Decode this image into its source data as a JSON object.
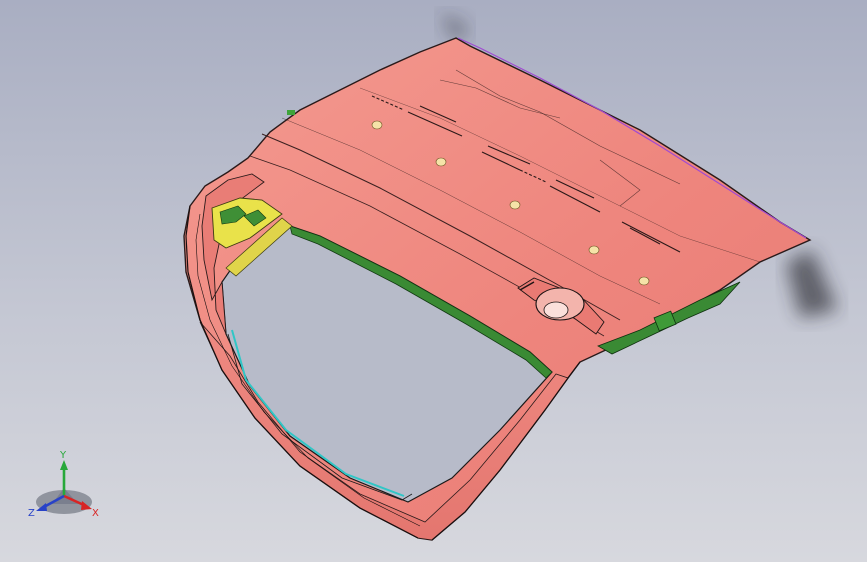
{
  "viewport": {
    "background_top": "#a9aec2",
    "background_bottom": "#d7d8de"
  },
  "model": {
    "part": "tailgate-panel",
    "body_color": "#f08a82",
    "edge_color": "#2a1a1a",
    "inner_color": "#2f7d2c",
    "bracket_color": "#e9e24a",
    "trim_color": "#a04ad2",
    "glass_edge_color": "#30c6c6"
  },
  "triad": {
    "y_label": "Y",
    "x_label": "X",
    "z_label": "Z",
    "y_color": "#27a83a",
    "x_color": "#d82424",
    "z_color": "#2842c8"
  }
}
